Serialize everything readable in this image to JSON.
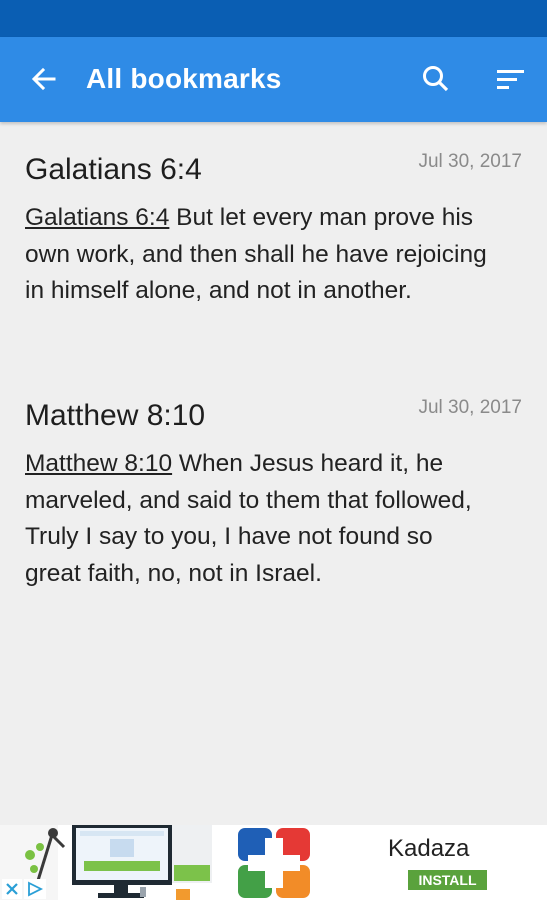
{
  "app_bar": {
    "title": "All bookmarks"
  },
  "bookmarks": [
    {
      "title": "Galatians 6:4",
      "date": "Jul 30, 2017",
      "reference": "Galatians 6:4",
      "text": " But let every man prove his own work, and then shall he have rejoicing in himself alone, and not in another."
    },
    {
      "title": "Matthew 8:10",
      "date": "Jul 30, 2017",
      "reference": "Matthew 8:10",
      "text": " When Jesus heard it, he marveled, and said to them that followed, Truly I say to you, I have not found so great faith, no, not in Israel."
    }
  ],
  "ad": {
    "name": "Kadaza",
    "install_label": "INSTALL"
  },
  "colors": {
    "status_bar": "#0a5eb3",
    "app_bar": "#2f8be6",
    "background": "#efefef",
    "install": "#5aa23c"
  }
}
